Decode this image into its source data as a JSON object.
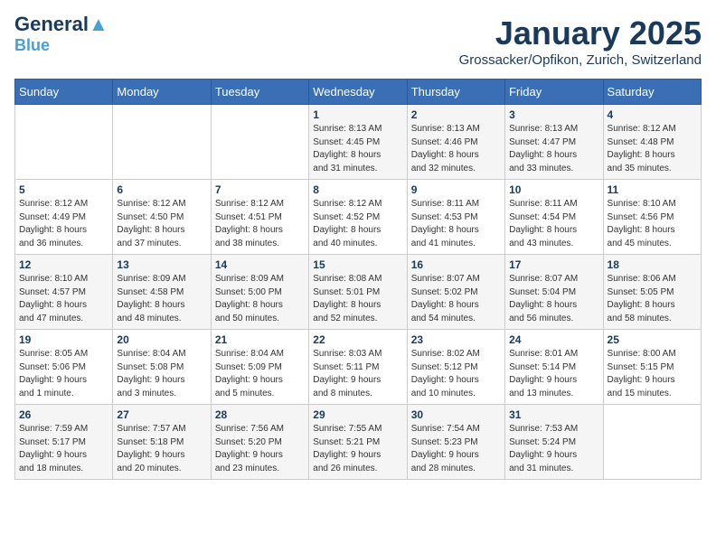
{
  "logo": {
    "general": "General",
    "blue": "Blue",
    "tagline": ""
  },
  "title": "January 2025",
  "location": "Grossacker/Opfikon, Zurich, Switzerland",
  "days_of_week": [
    "Sunday",
    "Monday",
    "Tuesday",
    "Wednesday",
    "Thursday",
    "Friday",
    "Saturday"
  ],
  "weeks": [
    [
      {
        "day": "",
        "info": ""
      },
      {
        "day": "",
        "info": ""
      },
      {
        "day": "",
        "info": ""
      },
      {
        "day": "1",
        "info": "Sunrise: 8:13 AM\nSunset: 4:45 PM\nDaylight: 8 hours\nand 31 minutes."
      },
      {
        "day": "2",
        "info": "Sunrise: 8:13 AM\nSunset: 4:46 PM\nDaylight: 8 hours\nand 32 minutes."
      },
      {
        "day": "3",
        "info": "Sunrise: 8:13 AM\nSunset: 4:47 PM\nDaylight: 8 hours\nand 33 minutes."
      },
      {
        "day": "4",
        "info": "Sunrise: 8:12 AM\nSunset: 4:48 PM\nDaylight: 8 hours\nand 35 minutes."
      }
    ],
    [
      {
        "day": "5",
        "info": "Sunrise: 8:12 AM\nSunset: 4:49 PM\nDaylight: 8 hours\nand 36 minutes."
      },
      {
        "day": "6",
        "info": "Sunrise: 8:12 AM\nSunset: 4:50 PM\nDaylight: 8 hours\nand 37 minutes."
      },
      {
        "day": "7",
        "info": "Sunrise: 8:12 AM\nSunset: 4:51 PM\nDaylight: 8 hours\nand 38 minutes."
      },
      {
        "day": "8",
        "info": "Sunrise: 8:12 AM\nSunset: 4:52 PM\nDaylight: 8 hours\nand 40 minutes."
      },
      {
        "day": "9",
        "info": "Sunrise: 8:11 AM\nSunset: 4:53 PM\nDaylight: 8 hours\nand 41 minutes."
      },
      {
        "day": "10",
        "info": "Sunrise: 8:11 AM\nSunset: 4:54 PM\nDaylight: 8 hours\nand 43 minutes."
      },
      {
        "day": "11",
        "info": "Sunrise: 8:10 AM\nSunset: 4:56 PM\nDaylight: 8 hours\nand 45 minutes."
      }
    ],
    [
      {
        "day": "12",
        "info": "Sunrise: 8:10 AM\nSunset: 4:57 PM\nDaylight: 8 hours\nand 47 minutes."
      },
      {
        "day": "13",
        "info": "Sunrise: 8:09 AM\nSunset: 4:58 PM\nDaylight: 8 hours\nand 48 minutes."
      },
      {
        "day": "14",
        "info": "Sunrise: 8:09 AM\nSunset: 5:00 PM\nDaylight: 8 hours\nand 50 minutes."
      },
      {
        "day": "15",
        "info": "Sunrise: 8:08 AM\nSunset: 5:01 PM\nDaylight: 8 hours\nand 52 minutes."
      },
      {
        "day": "16",
        "info": "Sunrise: 8:07 AM\nSunset: 5:02 PM\nDaylight: 8 hours\nand 54 minutes."
      },
      {
        "day": "17",
        "info": "Sunrise: 8:07 AM\nSunset: 5:04 PM\nDaylight: 8 hours\nand 56 minutes."
      },
      {
        "day": "18",
        "info": "Sunrise: 8:06 AM\nSunset: 5:05 PM\nDaylight: 8 hours\nand 58 minutes."
      }
    ],
    [
      {
        "day": "19",
        "info": "Sunrise: 8:05 AM\nSunset: 5:06 PM\nDaylight: 9 hours\nand 1 minute."
      },
      {
        "day": "20",
        "info": "Sunrise: 8:04 AM\nSunset: 5:08 PM\nDaylight: 9 hours\nand 3 minutes."
      },
      {
        "day": "21",
        "info": "Sunrise: 8:04 AM\nSunset: 5:09 PM\nDaylight: 9 hours\nand 5 minutes."
      },
      {
        "day": "22",
        "info": "Sunrise: 8:03 AM\nSunset: 5:11 PM\nDaylight: 9 hours\nand 8 minutes."
      },
      {
        "day": "23",
        "info": "Sunrise: 8:02 AM\nSunset: 5:12 PM\nDaylight: 9 hours\nand 10 minutes."
      },
      {
        "day": "24",
        "info": "Sunrise: 8:01 AM\nSunset: 5:14 PM\nDaylight: 9 hours\nand 13 minutes."
      },
      {
        "day": "25",
        "info": "Sunrise: 8:00 AM\nSunset: 5:15 PM\nDaylight: 9 hours\nand 15 minutes."
      }
    ],
    [
      {
        "day": "26",
        "info": "Sunrise: 7:59 AM\nSunset: 5:17 PM\nDaylight: 9 hours\nand 18 minutes."
      },
      {
        "day": "27",
        "info": "Sunrise: 7:57 AM\nSunset: 5:18 PM\nDaylight: 9 hours\nand 20 minutes."
      },
      {
        "day": "28",
        "info": "Sunrise: 7:56 AM\nSunset: 5:20 PM\nDaylight: 9 hours\nand 23 minutes."
      },
      {
        "day": "29",
        "info": "Sunrise: 7:55 AM\nSunset: 5:21 PM\nDaylight: 9 hours\nand 26 minutes."
      },
      {
        "day": "30",
        "info": "Sunrise: 7:54 AM\nSunset: 5:23 PM\nDaylight: 9 hours\nand 28 minutes."
      },
      {
        "day": "31",
        "info": "Sunrise: 7:53 AM\nSunset: 5:24 PM\nDaylight: 9 hours\nand 31 minutes."
      },
      {
        "day": "",
        "info": ""
      }
    ]
  ]
}
